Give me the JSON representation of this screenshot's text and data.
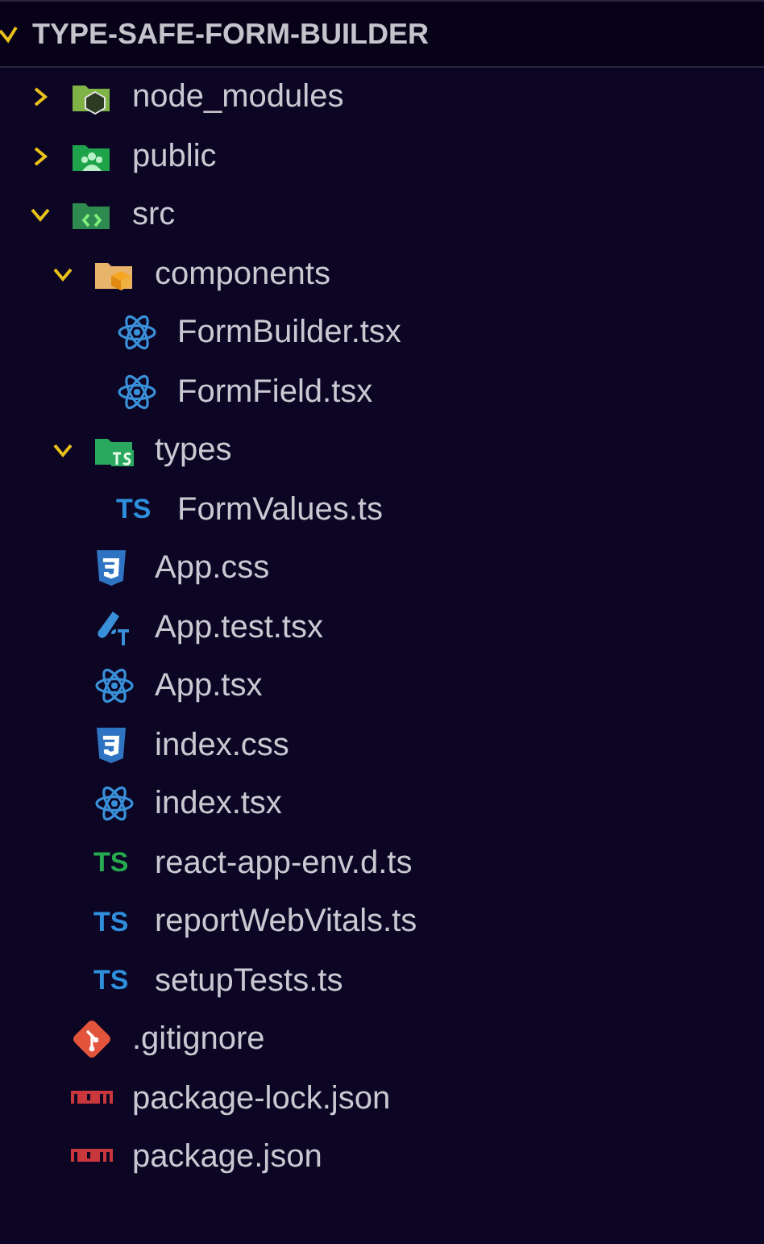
{
  "explorer": {
    "title": "TYPE-SAFE-FORM-BUILDER",
    "expanded": true
  },
  "tree": [
    {
      "name": "node_modules",
      "kind": "nodefolder",
      "expanded": false
    },
    {
      "name": "public",
      "kind": "peoplefolder",
      "expanded": false
    },
    {
      "name": "src",
      "kind": "codefolder",
      "expanded": true,
      "children": [
        {
          "name": "components",
          "kind": "componentfolder",
          "expanded": true,
          "children": [
            {
              "name": "FormBuilder.tsx",
              "kind": "react"
            },
            {
              "name": "FormField.tsx",
              "kind": "react"
            }
          ]
        },
        {
          "name": "types",
          "kind": "tsfolder",
          "expanded": true,
          "children": [
            {
              "name": "FormValues.ts",
              "kind": "typescript",
              "badge": "TS"
            }
          ]
        },
        {
          "name": "App.css",
          "kind": "css"
        },
        {
          "name": "App.test.tsx",
          "kind": "test"
        },
        {
          "name": "App.tsx",
          "kind": "react"
        },
        {
          "name": "index.css",
          "kind": "css"
        },
        {
          "name": "index.tsx",
          "kind": "react"
        },
        {
          "name": "react-app-env.d.ts",
          "kind": "typescriptenv",
          "badge": "TS"
        },
        {
          "name": "reportWebVitals.ts",
          "kind": "typescript",
          "badge": "TS"
        },
        {
          "name": "setupTests.ts",
          "kind": "typescript",
          "badge": "TS"
        }
      ]
    },
    {
      "name": ".gitignore",
      "kind": "git"
    },
    {
      "name": "package-lock.json",
      "kind": "npm"
    },
    {
      "name": "package.json",
      "kind": "npm"
    }
  ]
}
